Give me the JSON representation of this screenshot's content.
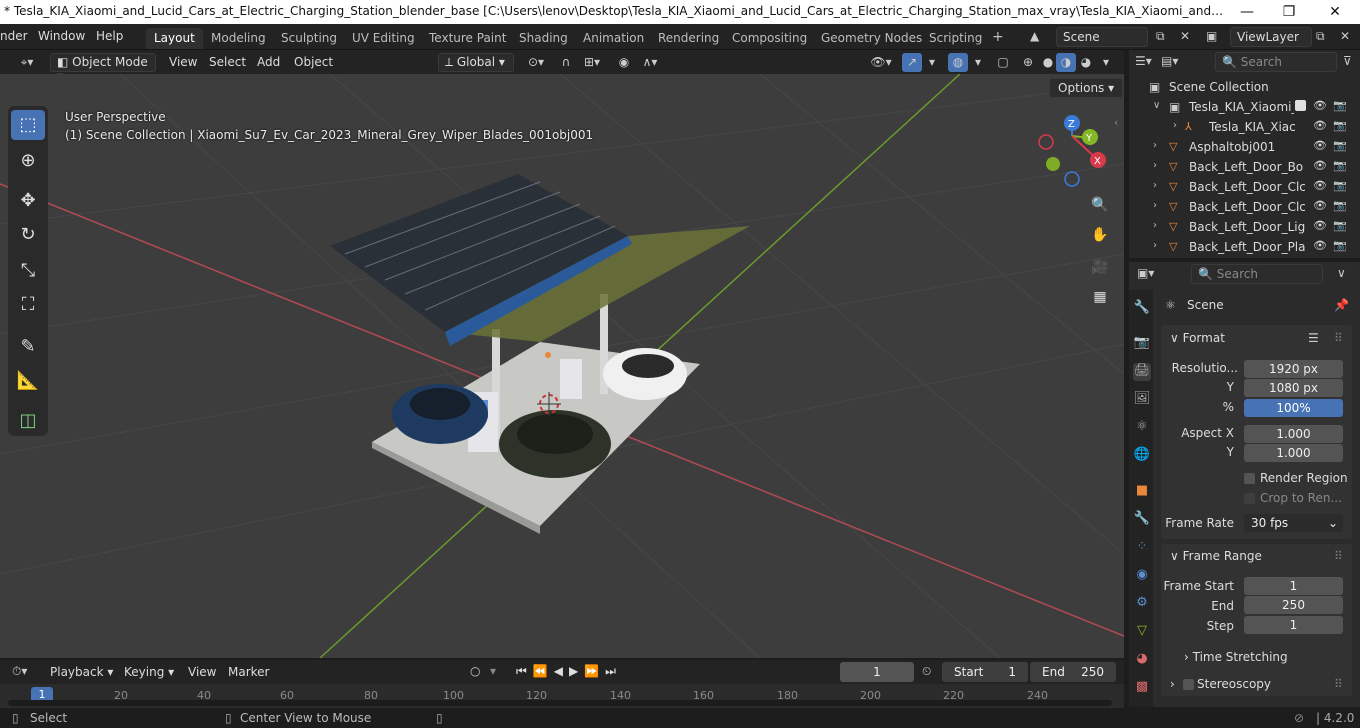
{
  "window": {
    "title": "* Tesla_KIA_Xiaomi_and_Lucid_Cars_at_Electric_Charging_Station_blender_base [C:\\Users\\lenov\\Desktop\\Tesla_KIA_Xiaomi_and_Lucid_Cars_at_Electric_Charging_Station_max_vray\\Tesla_KIA_Xiaomi_and_Lucid_Cars_at_Electric_...",
    "minimize": "—",
    "maximize": "❐",
    "close": "✕"
  },
  "menubar": {
    "items": [
      "nder",
      "Window",
      "Help"
    ],
    "workspaces": [
      "Layout",
      "Modeling",
      "Sculpting",
      "UV Editing",
      "Texture Paint",
      "Shading",
      "Animation",
      "Rendering",
      "Compositing",
      "Geometry Nodes",
      "Scripting"
    ],
    "active_workspace": "Layout",
    "add_tab": "+",
    "scene": "Scene",
    "view_layer": "ViewLayer"
  },
  "viewport_header": {
    "mode": "Object Mode",
    "menus": [
      "View",
      "Select",
      "Add",
      "Object"
    ],
    "transform_orientation": "Global",
    "options": "Options"
  },
  "viewport": {
    "perspective": "User Perspective",
    "collection_info": "(1) Scene Collection | Xiaomi_Su7_Ev_Car_2023_Mineral_Grey_Wiper_Blades_001obj001",
    "gizmo_axes": [
      "Z",
      "Y",
      "X"
    ]
  },
  "outliner": {
    "search_placeholder": "Search",
    "root": "Scene Collection",
    "items": [
      {
        "label": "Tesla_KIA_Xiaomi_",
        "kind": "collection"
      },
      {
        "label": "Tesla_KIA_Xiac",
        "kind": "armature"
      },
      {
        "label": "Asphaltobj001",
        "kind": "object"
      },
      {
        "label": "Back_Left_Door_Bo",
        "kind": "object"
      },
      {
        "label": "Back_Left_Door_Clc",
        "kind": "object"
      },
      {
        "label": "Back_Left_Door_Clc",
        "kind": "object"
      },
      {
        "label": "Back_Left_Door_Lig",
        "kind": "object"
      },
      {
        "label": "Back_Left_Door_Pla",
        "kind": "object"
      }
    ]
  },
  "properties": {
    "search_placeholder": "Search",
    "context": "Scene",
    "format": {
      "title": "Format",
      "resolution_x_label": "Resolutio...",
      "resolution_x": "1920 px",
      "resolution_y_label": "Y",
      "resolution_y": "1080 px",
      "percent_label": "%",
      "percent": "100%",
      "aspect_x_label": "Aspect X",
      "aspect_x": "1.000",
      "aspect_y_label": "Y",
      "aspect_y": "1.000",
      "render_region": "Render Region",
      "crop": "Crop to Ren...",
      "frame_rate_label": "Frame Rate",
      "frame_rate": "30 fps"
    },
    "frame_range": {
      "title": "Frame Range",
      "start_label": "Frame Start",
      "start": "1",
      "end_label": "End",
      "end": "250",
      "step_label": "Step",
      "step": "1"
    },
    "time_stretching": "Time Stretching",
    "stereoscopy": "Stereoscopy"
  },
  "timeline": {
    "menus": [
      "Playback",
      "Keying",
      "View",
      "Marker"
    ],
    "current_frame": "1",
    "start_label": "Start",
    "start": "1",
    "end_label": "End",
    "end": "250",
    "ticks": [
      "1",
      "20",
      "40",
      "60",
      "80",
      "100",
      "120",
      "140",
      "160",
      "180",
      "200",
      "220",
      "240"
    ]
  },
  "statusbar": {
    "select": "Select",
    "center": "Center View to Mouse",
    "version": "4.2.0"
  },
  "colors": {
    "accent": "#4772b3",
    "x_axis": "#d93a4a",
    "y_axis": "#84b825",
    "z_axis": "#3a7ad9",
    "object_orange": "#e8883a"
  }
}
